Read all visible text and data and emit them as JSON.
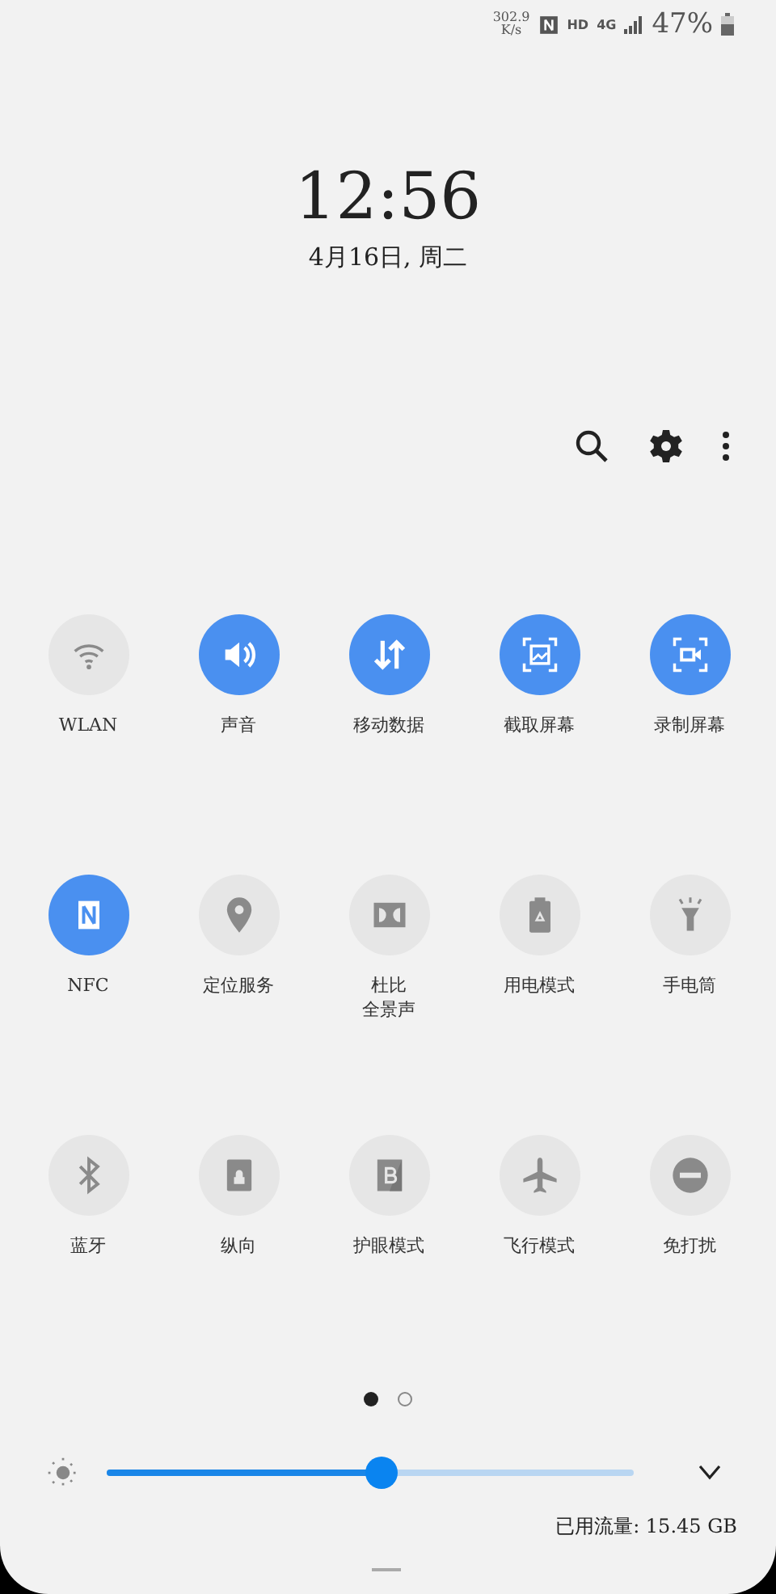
{
  "status_bar": {
    "net_speed": "302.9\nK/s",
    "network_type": "HD",
    "cell_gen": "4G",
    "battery": "47%"
  },
  "clock": {
    "time": "12:56",
    "date": "4月16日, 周二"
  },
  "tiles": [
    {
      "label": "WLAN",
      "kind": "wifi",
      "on": false
    },
    {
      "label": "声音",
      "kind": "sound",
      "on": true
    },
    {
      "label": "移动数据",
      "kind": "data",
      "on": true
    },
    {
      "label": "截取屏幕",
      "kind": "screenshot",
      "on": true
    },
    {
      "label": "录制屏幕",
      "kind": "record",
      "on": true
    },
    {
      "label": "NFC",
      "kind": "nfc",
      "on": true
    },
    {
      "label": "定位服务",
      "kind": "location",
      "on": false
    },
    {
      "lines": [
        "杜比",
        "全景声"
      ],
      "kind": "dolby",
      "on": false
    },
    {
      "label": "用电模式",
      "kind": "battery",
      "on": false
    },
    {
      "label": "手电筒",
      "kind": "flashlight",
      "on": false
    },
    {
      "label": "蓝牙",
      "kind": "bluetooth",
      "on": false
    },
    {
      "label": "纵向",
      "kind": "rotation",
      "on": false
    },
    {
      "label": "护眼模式",
      "kind": "bluelight",
      "on": false
    },
    {
      "label": "飞行模式",
      "kind": "airplane",
      "on": false
    },
    {
      "label": "免打扰",
      "kind": "dnd",
      "on": false
    }
  ],
  "pages": [
    {
      "selected": true
    },
    {
      "selected": false
    }
  ],
  "brightness": {
    "level": 0.52
  },
  "data_usage": "已用流量: 15.45 GB"
}
